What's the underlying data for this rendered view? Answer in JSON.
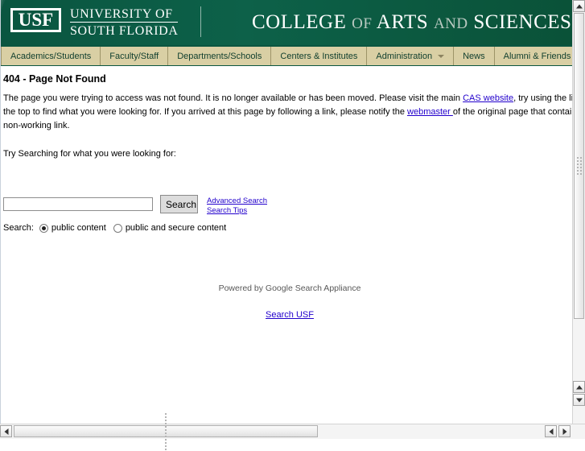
{
  "masthead": {
    "logo_text": "USF",
    "university_line1": "UNIVERSITY OF",
    "university_line2": "SOUTH FLORIDA",
    "college_part1": "COLLEGE",
    "college_of": "OF",
    "college_part2": "ARTS",
    "college_and": "AND",
    "college_part3": "SCIENCES",
    "brand_green": "#0a5540",
    "nav_tan": "#d9cfa4"
  },
  "nav": {
    "items": [
      {
        "label": "Academics/Students",
        "caret": false
      },
      {
        "label": "Faculty/Staff",
        "caret": false
      },
      {
        "label": "Departments/Schools",
        "caret": false
      },
      {
        "label": "Centers & Institutes",
        "caret": false
      },
      {
        "label": "Administration",
        "caret": true
      },
      {
        "label": "News",
        "caret": false
      },
      {
        "label": "Alumni & Friends",
        "caret": false
      }
    ]
  },
  "content": {
    "heading": "404 - Page Not Found",
    "paragraph1_a": "The page you were trying to access was not found. It is no longer available or has been moved. Please visit the main ",
    "link_cas": "CAS website",
    "paragraph1_b": ", try using the links on the top to find what you were looking for. If you arrived at this page by following a link, please notify the ",
    "link_webmaster": "webmaster ",
    "paragraph1_c": "of the original page that contained the non-working link.",
    "try_line": "Try Searching for what you were looking for:"
  },
  "search": {
    "value": "",
    "placeholder": "",
    "button_label": "Search",
    "advanced_search_label": "Advanced Search",
    "search_tips_label": "Search Tips",
    "scope_label": "Search:",
    "options": [
      {
        "label": "public content",
        "selected": true
      },
      {
        "label": "public and secure content",
        "selected": false
      }
    ]
  },
  "footer": {
    "powered_by": "Powered by Google Search Appliance",
    "search_usf_label": "Search USF"
  },
  "scrollbars": {
    "vertical_icon_up": "scroll-up-arrow",
    "vertical_icon_down": "scroll-down-arrow",
    "horizontal_icon_left": "scroll-left-arrow",
    "horizontal_icon_right": "scroll-right-arrow"
  }
}
